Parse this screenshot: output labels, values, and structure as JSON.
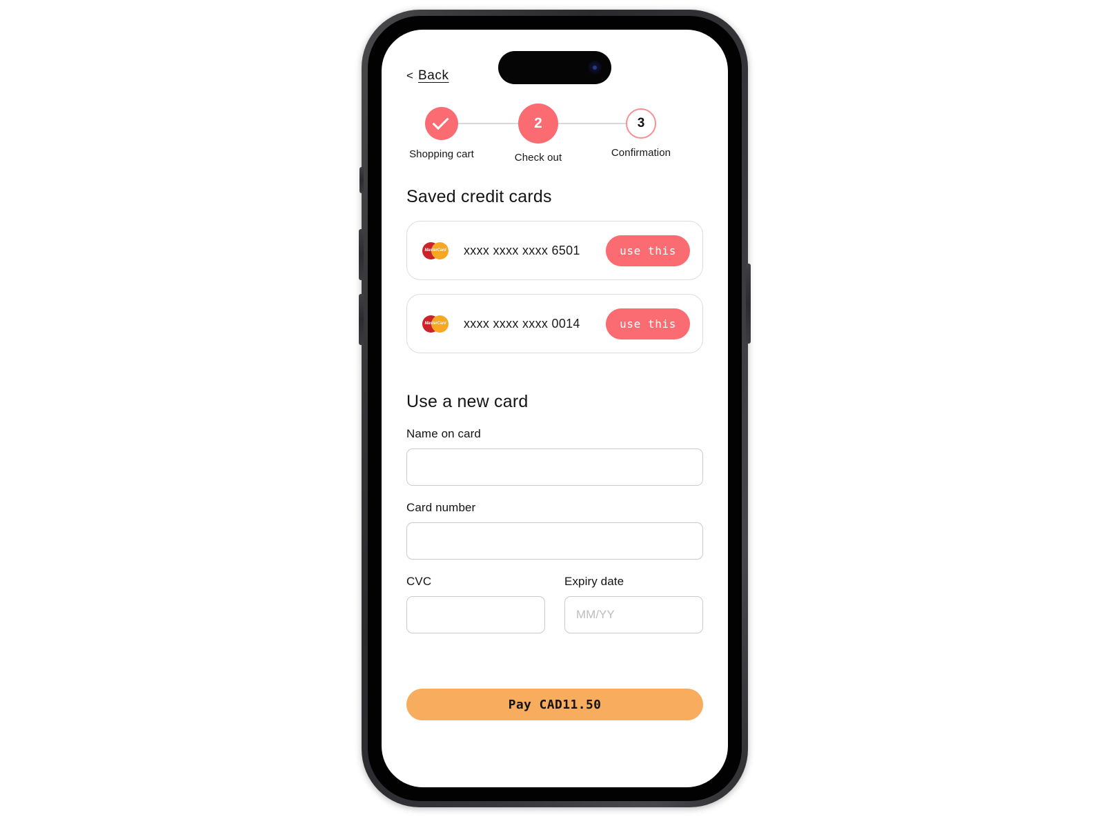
{
  "nav": {
    "back_chevron": "<",
    "back_label": "Back"
  },
  "stepper": {
    "steps": [
      {
        "id": "shopping-cart",
        "badge": "check-icon",
        "label": "Shopping cart",
        "state": "completed"
      },
      {
        "id": "check-out",
        "badge": "2",
        "label": "Check out",
        "state": "active"
      },
      {
        "id": "confirmation",
        "badge": "3",
        "label": "Confirmation",
        "state": "upcoming"
      }
    ]
  },
  "saved_cards": {
    "title": "Saved credit cards",
    "items": [
      {
        "brand": "mastercard",
        "number": "xxxx xxxx xxxx 6501",
        "action_label": "use this"
      },
      {
        "brand": "mastercard",
        "number": "xxxx xxxx xxxx 0014",
        "action_label": "use this"
      }
    ]
  },
  "new_card": {
    "title": "Use a new card",
    "fields": {
      "name": {
        "label": "Name on card",
        "value": "",
        "placeholder": ""
      },
      "number": {
        "label": "Card number",
        "value": "",
        "placeholder": ""
      },
      "cvc": {
        "label": "CVC",
        "value": "",
        "placeholder": ""
      },
      "expiry": {
        "label": "Expiry date",
        "value": "",
        "placeholder": "MM/YY"
      }
    }
  },
  "pay": {
    "label": "Pay CAD11.50",
    "currency": "CAD",
    "amount": "11.50"
  },
  "colors": {
    "accent_pink": "#fa6b72",
    "accent_pink_outline": "#fb8d92",
    "pay_orange": "#f8ac5d",
    "border_gray": "#dcdcdc",
    "input_border": "#cacaca",
    "mastercard_red": "#cc2229",
    "mastercard_yellow": "#f7a823"
  }
}
